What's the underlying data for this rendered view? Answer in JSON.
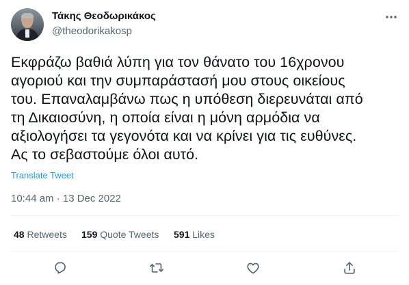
{
  "author": {
    "display_name": "Τάκης Θεοδωρικάκος",
    "handle": "@theodorikakosp"
  },
  "tweet": {
    "text_lines": [
      "Εκφράζω βαθιά λύπη για τον θάνατο του 16χρονου",
      "αγοριού και την συμπαράστασή μου στους οικείους",
      "του. Επαναλαμβάνω πως η υπόθεση διερευνάται από",
      "τη Δικαιοσύνη, η οποία είναι η μόνη αρμόδια να",
      "αξιολογήσει τα γεγονότα και να κρίνει για τις ευθύνες.",
      "Ας το σεβαστούμε όλοι αυτό."
    ],
    "translate_label": "Translate Tweet",
    "timestamp": "10:44 am · 13 Dec 2022"
  },
  "stats": {
    "retweets_count": "48",
    "retweets_label": "Retweets",
    "quotes_count": "159",
    "quotes_label": "Quote Tweets",
    "likes_count": "591",
    "likes_label": "Likes"
  },
  "icons": {
    "more": "more-icon",
    "reply": "reply-icon",
    "retweet": "retweet-icon",
    "like": "like-icon",
    "share": "share-icon"
  },
  "colors": {
    "text": "#0f1419",
    "secondary": "#536471",
    "accent": "#1d9bf0",
    "divider": "#eff3f4"
  }
}
